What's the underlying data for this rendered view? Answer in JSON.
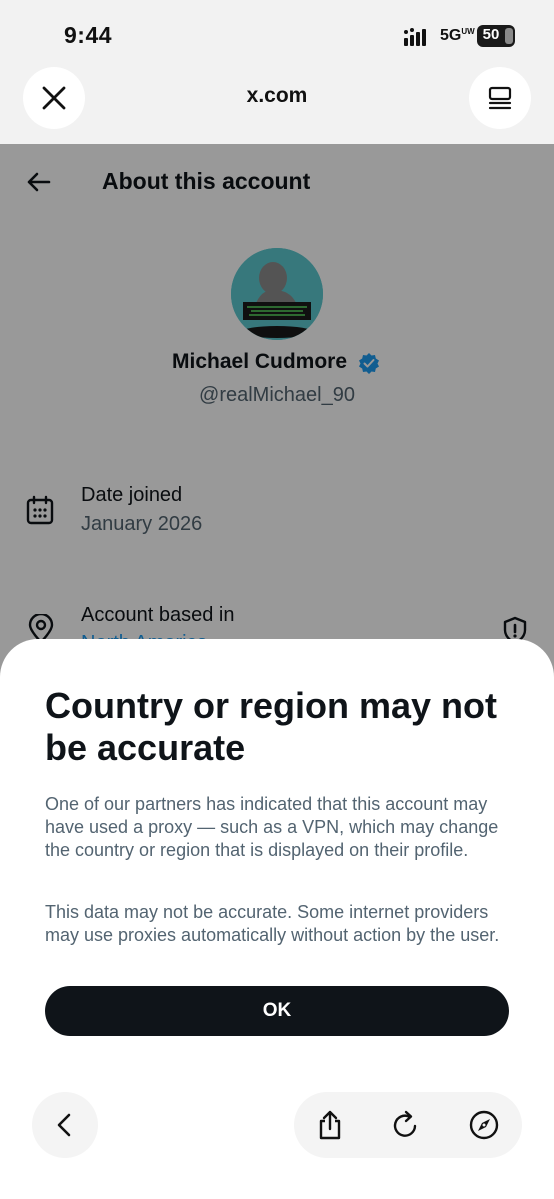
{
  "status_bar": {
    "time": "9:44",
    "network": "5G",
    "network_suffix": "UW",
    "battery": "50"
  },
  "browser": {
    "url": "x.com",
    "close_icon": "close-icon",
    "tabs_icon": "tabs-icon"
  },
  "page": {
    "header": {
      "title": "About this account",
      "back_icon": "arrow-left-icon"
    },
    "profile": {
      "display_name": "Michael Cudmore",
      "handle": "@realMichael_90",
      "verified": true
    },
    "info_rows": [
      {
        "label": "Date joined",
        "value": "January 2026",
        "icon": "calendar-icon"
      },
      {
        "label": "Account based in",
        "value": "North America",
        "icon": "location-pin-icon"
      }
    ]
  },
  "sheet": {
    "title": "Country or region may not be accurate",
    "paragraphs": [
      "One of our partners has indicated that this account may have used a proxy — such as a VPN, which may change the country or region that is displayed on their profile.",
      "This data may not be accurate. Some internet providers may use proxies automatically without action by the user."
    ],
    "ok_label": "OK"
  },
  "toolbar": {
    "icons": [
      "chevron-left-icon",
      "share-icon",
      "reload-icon",
      "compass-icon"
    ]
  },
  "colors": {
    "primary_text": "#0f1419",
    "secondary_text": "#536471",
    "verified_blue": "#1d9bf0",
    "button_bg": "#0f1419",
    "avatar_bg": "#5cc9cf"
  }
}
